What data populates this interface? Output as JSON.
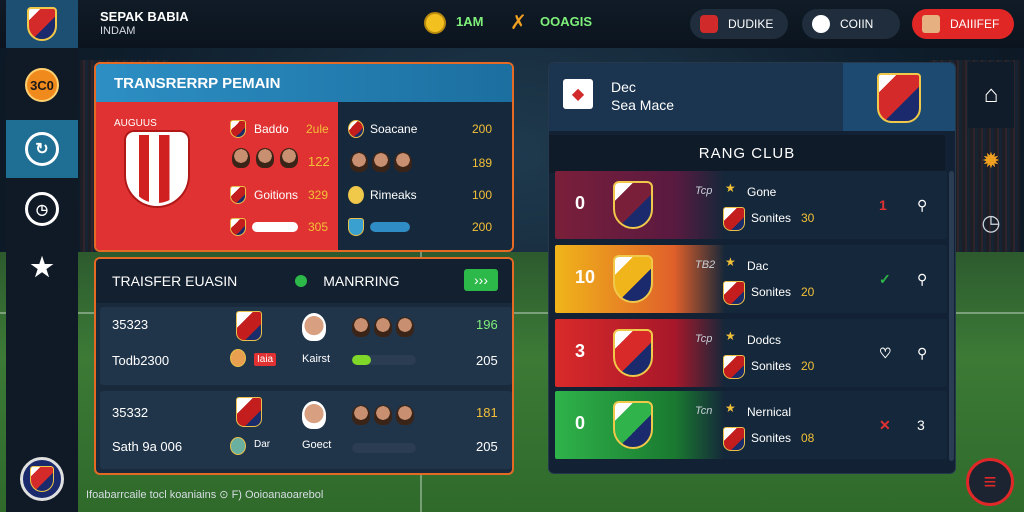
{
  "topbar": {
    "club_name": "SEPAK BABIA",
    "club_sub": "INDAM",
    "coins": "1AM",
    "rating": "OOAGIS",
    "pill1": "DUDIKE",
    "pill2": "COIIN",
    "pill3": "DAIIIFEF"
  },
  "sidebar": {
    "badge": "3C0"
  },
  "transfer": {
    "title": "TRANSRERRP PEMAIN",
    "left_label": "AUGUUS",
    "rows_mid": [
      {
        "label": "Baddo",
        "value": "2ule"
      },
      {
        "label": "",
        "value": "122"
      },
      {
        "label": "Goitions",
        "value": "329"
      },
      {
        "label": "",
        "value": "305"
      }
    ],
    "rows_right": [
      {
        "label": "Soacane",
        "value": "200"
      },
      {
        "label": "",
        "value": "189"
      },
      {
        "label": "Rimeaks",
        "value": "100"
      },
      {
        "label": "",
        "value": "200"
      }
    ]
  },
  "market": {
    "title_left": "TRAISFER EUASIN",
    "title_right": "MANRRING",
    "go_label": "›››",
    "rows": [
      {
        "id": "35323",
        "price": "Todb2300",
        "tag": "Iaia",
        "player": "Kairst",
        "value_top": "196",
        "value_bottom": "205"
      },
      {
        "id": "35332",
        "price": "Sath 9a 006",
        "tag": "Dar",
        "player": "Goect",
        "value_top": "181",
        "value_bottom": "205"
      }
    ]
  },
  "ranking": {
    "head_line1": "Dec",
    "head_line2": "Sea Mace",
    "title": "RANG CLUB",
    "rows": [
      {
        "rank": "0",
        "code": "Tcp",
        "name": "Gone",
        "sub": "Sonites",
        "pts": "30",
        "delta": "1",
        "colors": [
          "#7a1f3a",
          "#5a1a40"
        ]
      },
      {
        "rank": "10",
        "code": "TB2",
        "name": "Dac",
        "sub": "Sonites",
        "pts": "20",
        "delta": "✓",
        "colors": [
          "#f0b51a",
          "#e0602a"
        ]
      },
      {
        "rank": "3",
        "code": "Tcp",
        "name": "Dodcs",
        "sub": "Sonites",
        "pts": "20",
        "delta": "♡",
        "colors": [
          "#d92a2a",
          "#a8182a"
        ]
      },
      {
        "rank": "0",
        "code": "Tcn",
        "name": "Nernical",
        "sub": "Sonites",
        "pts": "08",
        "delta": "✕",
        "extra": "3",
        "colors": [
          "#2fb34a",
          "#1a7a30"
        ]
      }
    ]
  },
  "footer": {
    "text": "Ifoabarrcaile tocl koaniains  ⊙ F)  Ooioanaoarebol"
  }
}
